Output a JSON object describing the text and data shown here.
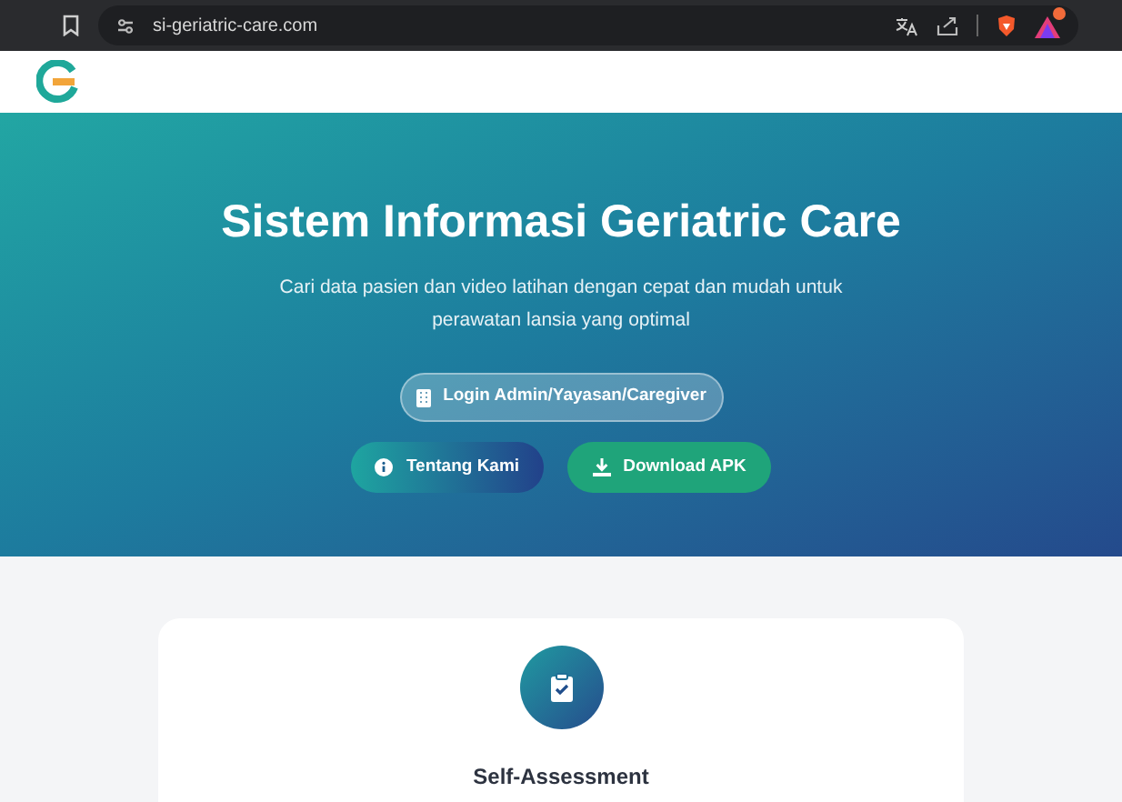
{
  "browser": {
    "url": "si-geriatric-care.com",
    "notification_badge": true
  },
  "hero": {
    "title": "Sistem Informasi Geriatric Care",
    "subtitle": "Cari data pasien dan video latihan dengan cepat dan mudah untuk perawatan lansia yang optimal",
    "buttons": [
      {
        "kind": "login",
        "label": "Login Admin/Yayasan/Caregiver"
      },
      {
        "kind": "about",
        "label": "Tentang Kami"
      },
      {
        "kind": "download",
        "label": "Download APK"
      }
    ]
  },
  "card": {
    "title": "Self-Assessment"
  }
}
